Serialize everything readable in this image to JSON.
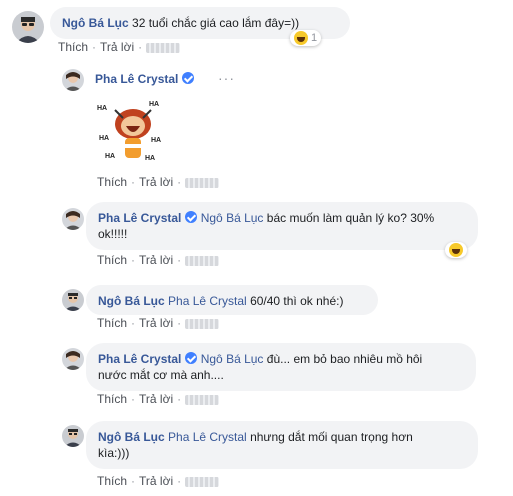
{
  "actions": {
    "like": "Thích",
    "reply": "Trả lời",
    "separator": "·"
  },
  "reaction": {
    "type": "haha-icon",
    "count": "1"
  },
  "comments": [
    {
      "author": "Ngô Bá Lục",
      "text": "32 tuổi chắc giá cao lắm đây=))"
    },
    {
      "author": "Pha Lê Crystal",
      "text": ""
    },
    {
      "author": "Pha Lê Crystal",
      "mention": "Ngô Bá Lục",
      "text_line1": "bác muốn làm quản lý ko? 30%",
      "text_line2": "ok!!!!!"
    },
    {
      "author": "Ngô Bá Lục",
      "mention": "Pha Lê Crystal",
      "text": "60/40 thì ok nhé:)"
    },
    {
      "author": "Pha Lê Crystal",
      "mention": "Ngô Bá Lục",
      "text_line1": "đù... em bỏ bao nhiêu mồ hôi",
      "text_line2": "nước mắt cơ mà anh...."
    },
    {
      "author": "Ngô Bá Lục",
      "mention": "Pha Lê Crystal",
      "text_line1": "nhưng dắt mối quan trọng hơn",
      "text_line2": "kìa:)))"
    }
  ],
  "sticker": {
    "label": "HA"
  },
  "colors": {
    "link": "#385898",
    "bubble": "#f2f3f5",
    "meta": "#90949c",
    "verified": "#4080ff"
  }
}
